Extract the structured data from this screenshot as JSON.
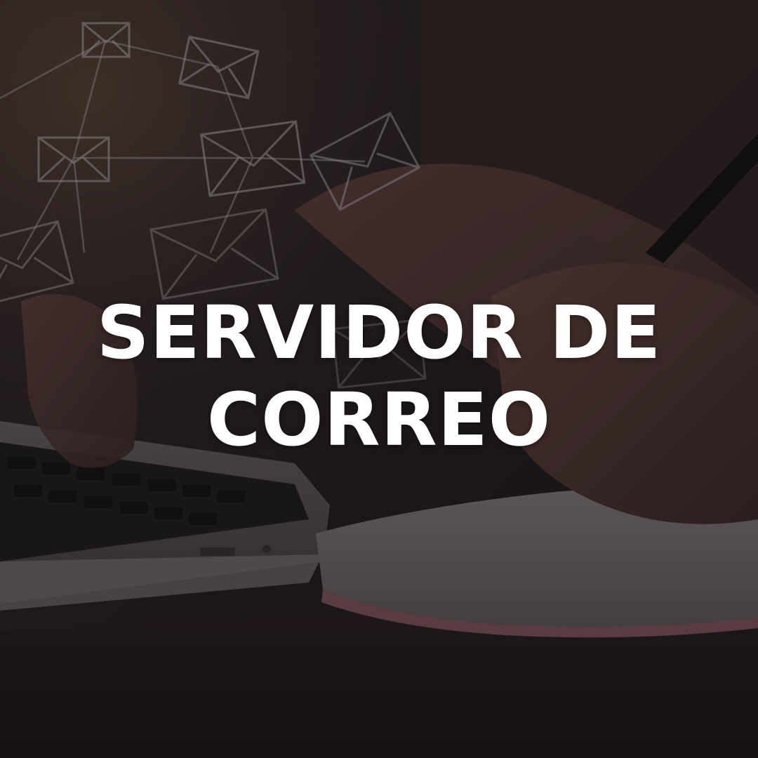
{
  "headline": {
    "line1": "SERVIDOR DE",
    "line2": "CORREO"
  },
  "scene": {
    "background_icon": "envelope-icon",
    "text_color": "#ffffff",
    "overlay_color": "#0a080a"
  }
}
